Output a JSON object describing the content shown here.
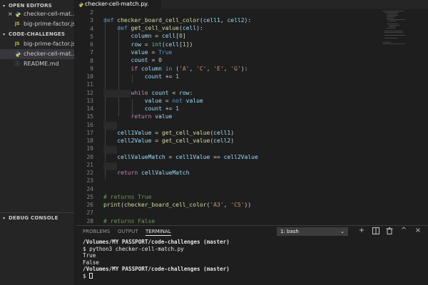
{
  "sidebar": {
    "open_editors": {
      "title": "OPEN EDITORS",
      "items": [
        {
          "label": "checker-cell-mat...",
          "icon": "python-icon"
        },
        {
          "label": "big-prime-factor.js",
          "icon": "js-icon"
        }
      ]
    },
    "project": {
      "title": "CODE-CHALLENGES",
      "items": [
        {
          "label": "big-prime-factor.js",
          "icon": "js-icon"
        },
        {
          "label": "checker-cell-mat...",
          "icon": "python-icon"
        },
        {
          "label": "README.md",
          "icon": "info-icon"
        }
      ]
    },
    "debug_console": {
      "title": "DEBUG CONSOLE"
    }
  },
  "icons": {
    "close": "×",
    "caret_open": "▾",
    "caret_closed": "›",
    "js_badge": "JS",
    "info": "ⓘ"
  },
  "editor": {
    "tab": {
      "label": "checker-cell-match.py",
      "more": "..."
    },
    "line_numbers": [
      "2",
      "3",
      "4",
      "5",
      "6",
      "7",
      "8",
      "9",
      "10",
      "11",
      "12",
      "13",
      "14",
      "15",
      "16",
      "17",
      "18",
      "19",
      "20",
      "21",
      "22",
      "23",
      "24",
      "25",
      "26",
      "27",
      "28"
    ]
  },
  "panel": {
    "tabs": [
      "PROBLEMS",
      "OUTPUT",
      "TERMINAL"
    ],
    "active_tab": "TERMINAL",
    "terminal_select": "1: bash",
    "actions": {
      "add": "+",
      "split": "▯",
      "trash": "🗑",
      "maximize": "^",
      "close": "×"
    },
    "terminal_lines": [
      "/Volumes/MY PASSPORT/code-challenges (master)",
      "$ python3 checker-cell-match.py",
      "True",
      "False",
      "/Volumes/MY PASSPORT/code-challenges (master)",
      "$ "
    ]
  },
  "colors": {
    "editor_bg": "#1e1e1e",
    "sidebar_bg": "#252526",
    "keyword": "#569cd6",
    "function": "#dcdcaa",
    "string": "#ce9178",
    "number": "#b5cea8",
    "comment": "#6a9955"
  }
}
